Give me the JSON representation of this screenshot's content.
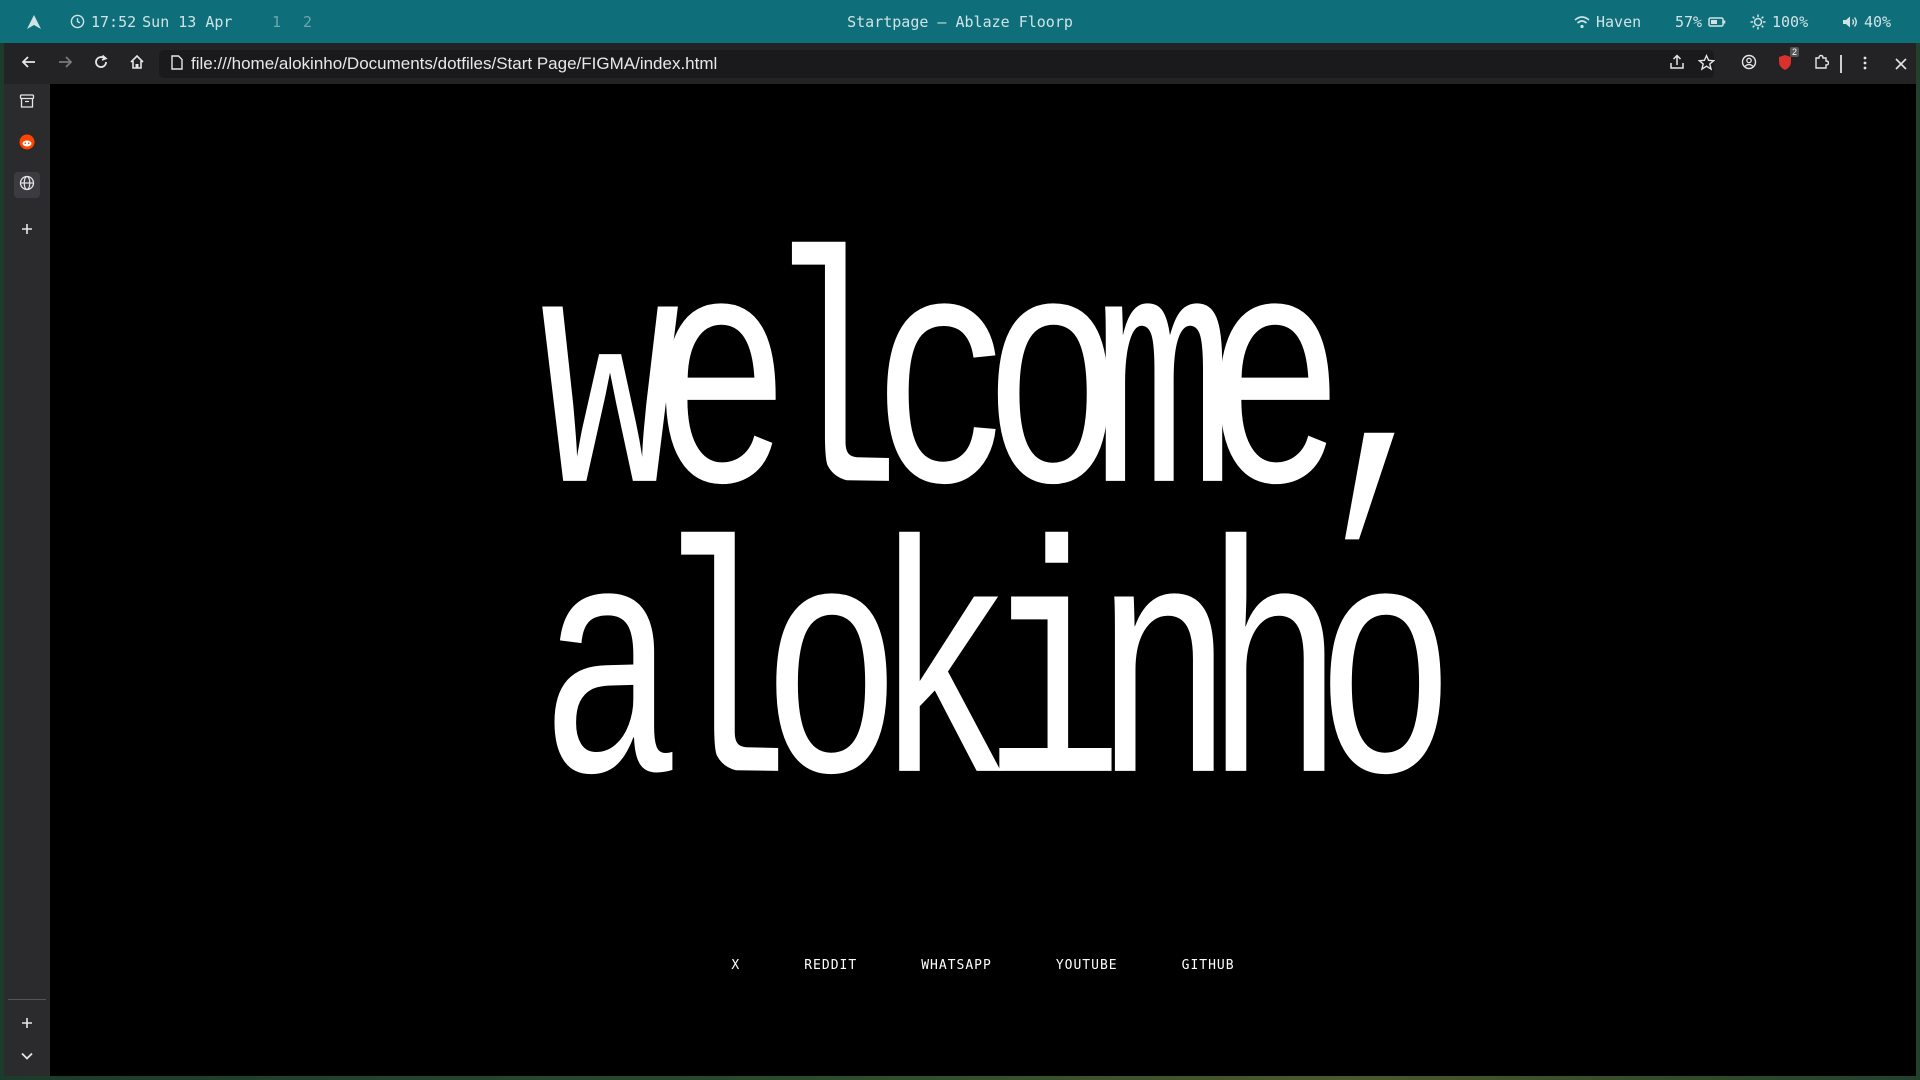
{
  "system_bar": {
    "time": "17:52",
    "date": "Sun 13 Apr",
    "workspaces": [
      "1",
      "2"
    ],
    "window_title": "Startpage — Ablaze Floorp",
    "wifi_name": "Haven",
    "battery": "57%",
    "brightness": "100%",
    "volume": "40%"
  },
  "browser": {
    "url": "file:///home/alokinho/Documents/dotfiles/Start Page/FIGMA/index.html",
    "extension_badge": "2"
  },
  "page": {
    "line1": "welcome,",
    "line2": "alokinho",
    "links": [
      "X",
      "REDDIT",
      "WHATSAPP",
      "YOUTUBE",
      "GITHUB"
    ]
  },
  "colors": {
    "system_bar": "#0e6f7a",
    "page_bg": "#000000",
    "text": "#ffffff",
    "extension_accent": "#d9312b"
  }
}
